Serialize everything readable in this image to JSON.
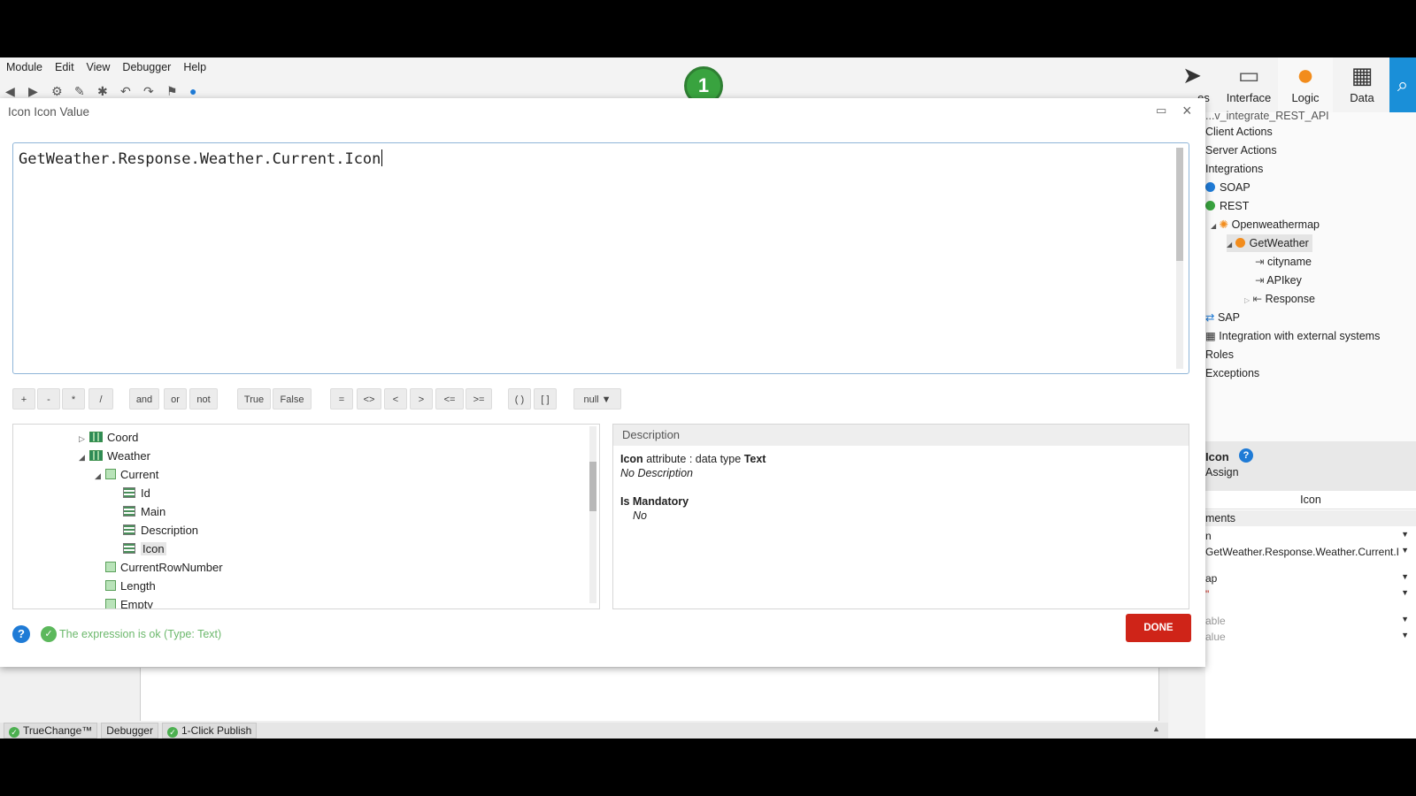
{
  "menu": [
    "Module",
    "Edit",
    "View",
    "Debugger",
    "Help"
  ],
  "step_badge": "1",
  "nav_tabs": [
    {
      "label": "es",
      "icon": "processes-icon"
    },
    {
      "label": "Interface",
      "icon": "interface-icon"
    },
    {
      "label": "Logic",
      "icon": "logic-icon"
    },
    {
      "label": "Data",
      "icon": "data-icon"
    }
  ],
  "right_tree": {
    "top_cut": "...v_integrate_REST_API",
    "items": [
      "Client Actions",
      "Server Actions",
      "Integrations",
      "SOAP",
      "REST",
      "Openweathermap",
      "GetWeather",
      "cityname",
      "APIkey",
      "Response",
      "SAP",
      "Integration with external systems",
      "Roles",
      "Exceptions"
    ]
  },
  "properties": {
    "title": "Icon",
    "subtitle": "Assign",
    "tab": "Icon",
    "section": "ments",
    "rows": [
      "n",
      "GetWeather.Response.Weather.Current.I",
      "ap",
      "\"",
      "able",
      "alue"
    ]
  },
  "status_bar": [
    "TrueChange™",
    "Debugger",
    "1-Click Publish"
  ],
  "dialog": {
    "title": "Icon Icon Value",
    "expression": "GetWeather.Response.Weather.Current.Icon",
    "operators": [
      "+",
      "-",
      "*",
      "/",
      "and",
      "or",
      "not",
      "True",
      "False",
      "=",
      "<>",
      "<",
      ">",
      "<=",
      ">=",
      "( )",
      "[ ]",
      "null ▼"
    ],
    "tree": [
      "Coord",
      "Weather",
      "Current",
      "Id",
      "Main",
      "Description",
      "Icon",
      "CurrentRowNumber",
      "Length",
      "Empty"
    ],
    "description": {
      "header": "Description",
      "name": "Icon",
      "type_prefix": "attribute : data type",
      "type": "Text",
      "no_desc": "No Description",
      "mandatory_label": "Is Mandatory",
      "mandatory_value": "No"
    },
    "status_message": "The expression is ok (Type: Text)",
    "done_label": "DONE"
  },
  "colors": {
    "accent": "#1a8fd8",
    "done": "#cf2418",
    "ok": "#5cb85c",
    "badge": "#39a33f"
  }
}
